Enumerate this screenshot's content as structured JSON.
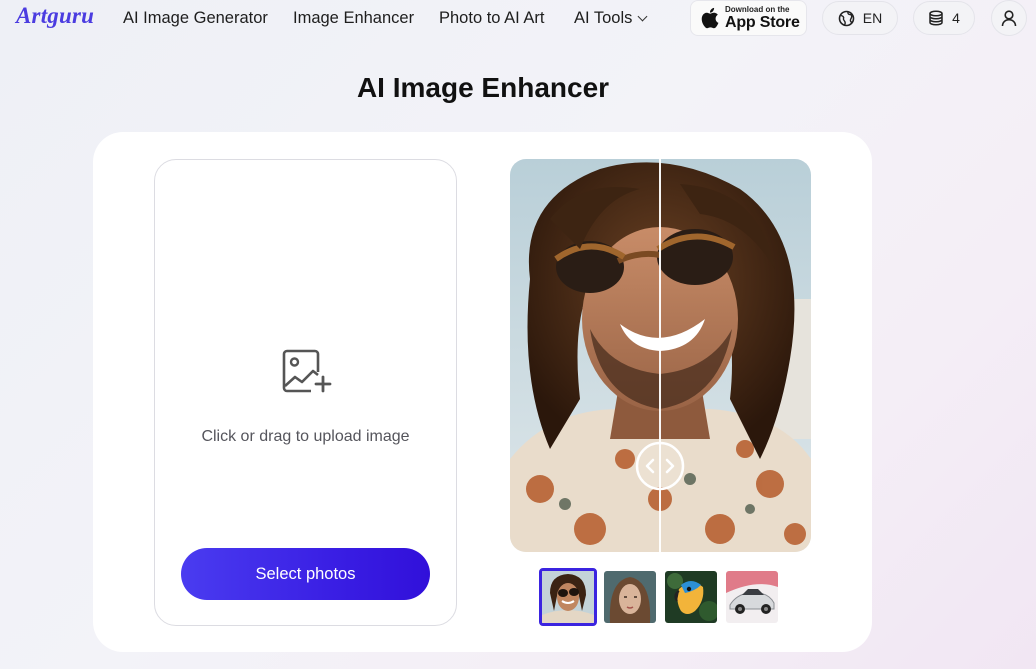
{
  "header": {
    "logo": "Artguru",
    "nav": [
      {
        "label": "AI Image Generator"
      },
      {
        "label": "Image Enhancer"
      },
      {
        "label": "Photo to AI Art"
      },
      {
        "label": "AI Tools"
      }
    ],
    "app_store": {
      "small": "Download on the",
      "big": "App Store"
    },
    "language": "EN",
    "credits": "4"
  },
  "main": {
    "title": "AI Image Enhancer",
    "upload": {
      "prompt": "Click or drag to upload image",
      "button": "Select photos"
    },
    "samples": [
      {
        "name": "sample-man-sunglasses",
        "selected": true
      },
      {
        "name": "sample-woman-portrait",
        "selected": false
      },
      {
        "name": "sample-parrot",
        "selected": false
      },
      {
        "name": "sample-sports-car",
        "selected": false
      }
    ]
  },
  "colors": {
    "accent": "#3b24e0",
    "logo": "#4b3ce0"
  }
}
